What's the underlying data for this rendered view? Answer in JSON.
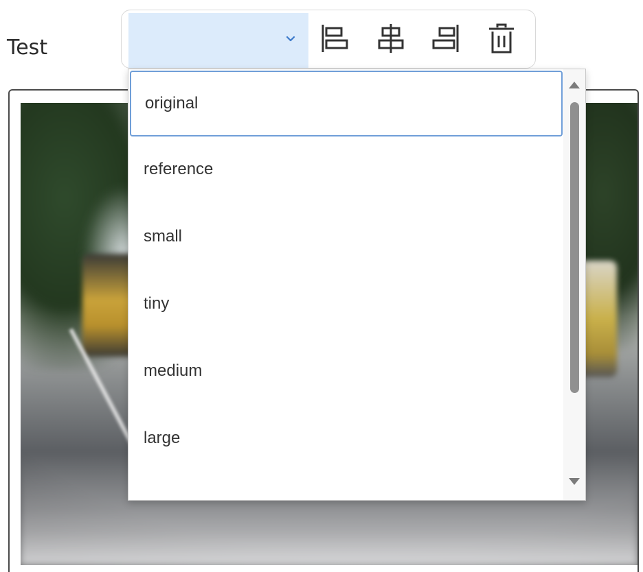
{
  "field": {
    "label": "Test"
  },
  "toolbar": {
    "size_select": {
      "selected_value": "",
      "chevron_icon": "chevron-down-icon",
      "accent_color": "#dcebfb"
    },
    "buttons": [
      {
        "icon": "align-left-icon"
      },
      {
        "icon": "align-center-icon"
      },
      {
        "icon": "align-right-icon"
      },
      {
        "icon": "trash-icon"
      }
    ]
  },
  "dropdown": {
    "options": [
      {
        "label": "original",
        "selected": true
      },
      {
        "label": "reference",
        "selected": false
      },
      {
        "label": "small",
        "selected": false
      },
      {
        "label": "tiny",
        "selected": false
      },
      {
        "label": "medium",
        "selected": false
      },
      {
        "label": "large",
        "selected": false
      }
    ]
  },
  "colors": {
    "selected_border": "#6f9ed8",
    "chevron": "#3a78c9",
    "icon_stroke": "#333333"
  }
}
